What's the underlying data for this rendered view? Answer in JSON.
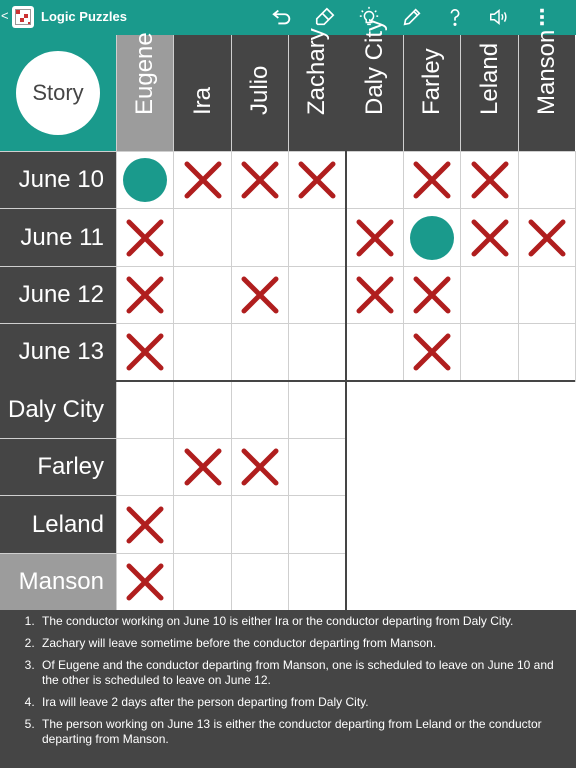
{
  "topbar": {
    "back": "<",
    "title": "Logic Puzzles",
    "icons": [
      "undo-icon",
      "eraser-icon",
      "hint-bulb-icon",
      "pencil-icon",
      "help-icon",
      "sound-icon",
      "more-vert-icon"
    ]
  },
  "corner_label": "Story",
  "columns": [
    "Eugene",
    "Ira",
    "Julio",
    "Zachary",
    "Daly City",
    "Farley",
    "Leland",
    "Manson"
  ],
  "rows": [
    "June 10",
    "June 11",
    "June 12",
    "June 13",
    "Daly City",
    "Farley",
    "Leland",
    "Manson"
  ],
  "selected": {
    "column": "Eugene",
    "row": "Manson"
  },
  "grid": [
    [
      "O",
      "X",
      "X",
      "X",
      "",
      "X",
      "X",
      ""
    ],
    [
      "X",
      "",
      "",
      "",
      "X",
      "O",
      "X",
      "X"
    ],
    [
      "X",
      "",
      "X",
      "",
      "X",
      "X",
      "",
      ""
    ],
    [
      "X",
      "",
      "",
      "",
      "",
      "X",
      "",
      ""
    ],
    [
      "",
      "",
      "",
      "",
      "",
      "",
      "",
      ""
    ],
    [
      "",
      "X",
      "X",
      "",
      "",
      "",
      "",
      ""
    ],
    [
      "X",
      "",
      "",
      "",
      "",
      "",
      "",
      ""
    ],
    [
      "X",
      "",
      "",
      "",
      "",
      "",
      "",
      ""
    ]
  ],
  "clues": [
    "The conductor working on June 10 is either Ira or the conductor departing from Daly City.",
    "Zachary will leave sometime before the conductor departing from Manson.",
    "Of Eugene and the conductor departing from Manson, one is scheduled to leave on June 10 and the other is scheduled to leave on June 12.",
    "Ira will leave 2 days after the person departing from Daly City.",
    "The person working on June 13 is either the conductor departing from Leland or the conductor departing from Manson."
  ],
  "colors": {
    "accent": "#1a9a8c",
    "header": "#454545",
    "selected": "#9c9c9c",
    "cross": "#b01e1e"
  }
}
